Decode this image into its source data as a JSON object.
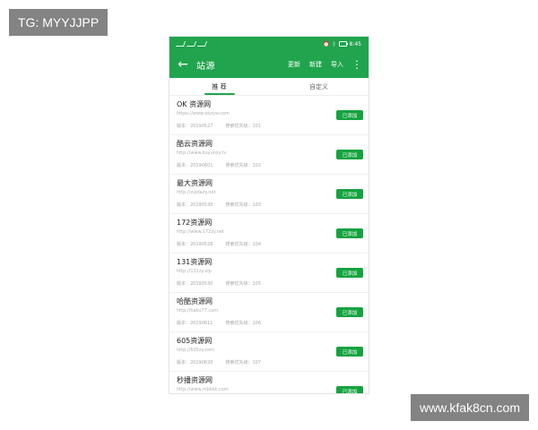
{
  "watermarks": {
    "top_left": "TG: MYYJJPP",
    "bottom_right": "www.kfak8cn.com"
  },
  "status_bar": {
    "left_text": "",
    "time": "8:45"
  },
  "app_bar": {
    "title": "站源",
    "actions": {
      "update": "更新",
      "new": "新建",
      "import": "导入"
    },
    "icons": {
      "back": "arrow-left-icon",
      "more": "more-vertical-icon"
    }
  },
  "tabs": [
    {
      "label": "推 荐"
    },
    {
      "label": "自定义"
    }
  ],
  "sources": [
    {
      "name": "OK 资源网",
      "url": "https://www.okzyw.com",
      "version": "版本：20190527",
      "priority": "搜索优先级：101",
      "status": "已添加"
    },
    {
      "name": "酷云资源网",
      "url": "http://www.kuyunzy.tv",
      "version": "版本：20190601",
      "priority": "搜索优先级：102",
      "status": "已添加"
    },
    {
      "name": "最大资源网",
      "url": "http://zuidazy.net",
      "version": "版本：20190530",
      "priority": "搜索优先级：103",
      "status": "已添加"
    },
    {
      "name": "172资源网",
      "url": "http://www.172zy.net",
      "version": "版本：20190528",
      "priority": "搜索优先级：104",
      "status": "已添加"
    },
    {
      "name": "131资源网",
      "url": "http://131zy.vip",
      "version": "版本：20190530",
      "priority": "搜索优先级：105",
      "status": "已添加"
    },
    {
      "name": "哈酷资源网",
      "url": "http://haku77.com",
      "version": "版本：20190611",
      "priority": "搜索优先级：106",
      "status": "已添加"
    },
    {
      "name": "605资源网",
      "url": "http://605zy.com",
      "version": "版本：20190620",
      "priority": "搜索优先级：107",
      "status": "已添加"
    },
    {
      "name": "秒播资源网",
      "url": "http://www.mbkkk.com",
      "version": "",
      "priority": "",
      "status": "已添加"
    }
  ],
  "colors": {
    "primary": "#21a44e",
    "button": "#15a33f"
  }
}
